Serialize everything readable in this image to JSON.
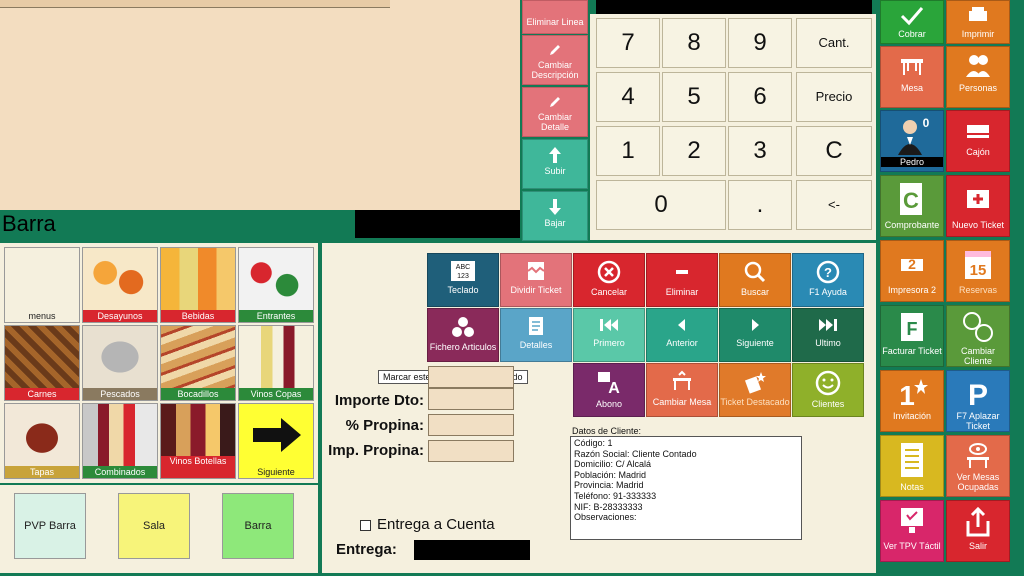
{
  "ticket_area": {
    "section_label": "Barra"
  },
  "line_actions": [
    {
      "label": "Eliminar Linea",
      "icon": "trash-icon",
      "color": "#e3737a"
    },
    {
      "label": "Cambiar Descripción",
      "icon": "pencil-icon",
      "color": "#e3737a"
    },
    {
      "label": "Cambiar Detalle",
      "icon": "pencil-icon",
      "color": "#e3737a"
    },
    {
      "label": "Subir",
      "icon": "arrow-up-icon",
      "color": "#3fb79a"
    },
    {
      "label": "Bajar",
      "icon": "arrow-down-icon",
      "color": "#3fb79a"
    }
  ],
  "keypad": {
    "keys": [
      [
        "7",
        "8",
        "9",
        "Cant."
      ],
      [
        "4",
        "5",
        "6",
        "Precio"
      ],
      [
        "1",
        "2",
        "3",
        "C"
      ],
      [
        "0",
        ".",
        "<-"
      ]
    ]
  },
  "categories": [
    {
      "label": "menus",
      "bar_color": "#f5f0de",
      "text_color": "#222"
    },
    {
      "label": "Desayunos",
      "bar_color": "#d8262e"
    },
    {
      "label": "Bebidas",
      "bar_color": "#d8262e"
    },
    {
      "label": "Entrantes",
      "bar_color": "#2c8a3a"
    },
    {
      "label": "Carnes",
      "bar_color": "#d8262e"
    },
    {
      "label": "Pescados",
      "bar_color": "#8a7a60"
    },
    {
      "label": "Bocadillos",
      "bar_color": "#2c8a3a"
    },
    {
      "label": "Vinos Copas",
      "bar_color": "#2c8a3a"
    },
    {
      "label": "Tapas",
      "bar_color": "#c8a33a"
    },
    {
      "label": "Combinados",
      "bar_color": "#2c8a3a"
    },
    {
      "label": "Vinos Botellas",
      "bar_color": "#d8262e"
    },
    {
      "label": "Siguiente",
      "bar_color": "#ffff33",
      "text_color": "#222"
    }
  ],
  "bottom_buttons": [
    {
      "label": "PVP Barra",
      "color": "#d9f2e6"
    },
    {
      "label": "Sala",
      "color": "#f7f47a"
    },
    {
      "label": "Barra",
      "color": "#8ee87a"
    }
  ],
  "function_buttons": [
    {
      "label": "Teclado",
      "color": "#1f5f7a",
      "icon": "keyboard-icon"
    },
    {
      "label": "Dividir Ticket",
      "color": "#e3737a",
      "icon": "split-ticket-icon"
    },
    {
      "label": "Cancelar",
      "color": "#d8262e",
      "icon": "cancel-icon"
    },
    {
      "label": "Eliminar",
      "color": "#d8262e",
      "icon": "minus-icon"
    },
    {
      "label": "Buscar",
      "color": "#e0791f",
      "icon": "search-icon"
    },
    {
      "label": "F1 Ayuda",
      "color": "#2a8ab4",
      "icon": "help-icon"
    },
    {
      "label": "Fichero Articulos",
      "color": "#8a2a5a",
      "icon": "articles-icon"
    },
    {
      "label": "Detalles",
      "color": "#5aa5c8",
      "icon": "details-icon"
    },
    {
      "label": "Primero",
      "color": "#5ac8a8",
      "icon": "first-icon"
    },
    {
      "label": "Anterior",
      "color": "#2aa58a",
      "icon": "previous-icon"
    },
    {
      "label": "Siguiente",
      "color": "#1f8a6a",
      "icon": "next-icon"
    },
    {
      "label": "Ultimo",
      "color": "#1f6a4a",
      "icon": "last-icon"
    },
    {
      "label": "Abono",
      "color": "#7a2a6a",
      "icon": "abono-icon"
    },
    {
      "label": "Cambiar Mesa",
      "color": "#e3737a",
      "icon": "change-table-icon"
    },
    {
      "label": "Ticket Destacado",
      "color": "#e07a2a",
      "icon": "star-ticket-icon"
    },
    {
      "label": "Clientes",
      "color": "#8fb02a",
      "icon": "smiley-icon"
    }
  ],
  "tooltip": "Marcar este ticket como destacado",
  "fields": {
    "importe_dto": "Importe Dto:",
    "propina": "% Propina:",
    "imp_propina": "Imp. Propina:",
    "entrega_cuenta": "Entrega a Cuenta",
    "entrega": "Entrega:"
  },
  "client": {
    "title": "Datos de Cliente:",
    "lines": [
      "Código: 1",
      "Razón Social: Cliente Contado",
      "Domicilio: C/ Alcalá",
      "Población: Madrid",
      "Provincia: Madrid",
      "Teléfono: 91-333333",
      "NIF: B-28333333",
      "Observaciones:"
    ]
  },
  "right_buttons": [
    {
      "label": "Cobrar",
      "color": "#2aa53a",
      "icon": "checkmark-icon"
    },
    {
      "label": "Imprimir",
      "color": "#e0791f",
      "icon": "printer-icon"
    },
    {
      "label": "Mesa",
      "color": "#e36a4a",
      "icon": "table-icon"
    },
    {
      "label": "Personas",
      "color": "#e0791f",
      "icon": "people-icon"
    },
    {
      "label": "Pedro",
      "color": "#1f6a9a",
      "icon": "waiter-icon",
      "badge": "0"
    },
    {
      "label": "Cajón",
      "color": "#d8262e",
      "icon": "cash-drawer-icon"
    },
    {
      "label": "Comprobante",
      "color": "#5a9a3a",
      "icon": "receipt-icon"
    },
    {
      "label": "Nuevo Ticket",
      "color": "#d8262e",
      "icon": "new-ticket-icon"
    },
    {
      "label": "Impresora 2",
      "color": "#e0791f",
      "icon": "printer-2-icon"
    },
    {
      "label": "Reservas",
      "color": "#e0791f",
      "icon": "calendar-icon",
      "badge": "15"
    },
    {
      "label": "Facturar Ticket",
      "color": "#2a8a4a",
      "icon": "invoice-icon"
    },
    {
      "label": "Cambiar Cliente",
      "color": "#5a9a3a",
      "icon": "swap-client-icon"
    },
    {
      "label": "Invitación",
      "color": "#e0791f",
      "icon": "invitation-icon"
    },
    {
      "label": "F7 Aplazar Ticket",
      "color": "#2a7aba",
      "icon": "postpone-icon"
    },
    {
      "label": "Notas",
      "color": "#d8b820",
      "icon": "notes-icon"
    },
    {
      "label": "Ver Mesas Ocupadas",
      "color": "#e36a4a",
      "icon": "occupied-tables-icon"
    },
    {
      "label": "Ver TPV Táctil",
      "color": "#d8266a",
      "icon": "touch-tpv-icon"
    },
    {
      "label": "Salir",
      "color": "#d8262e",
      "icon": "exit-icon"
    }
  ]
}
